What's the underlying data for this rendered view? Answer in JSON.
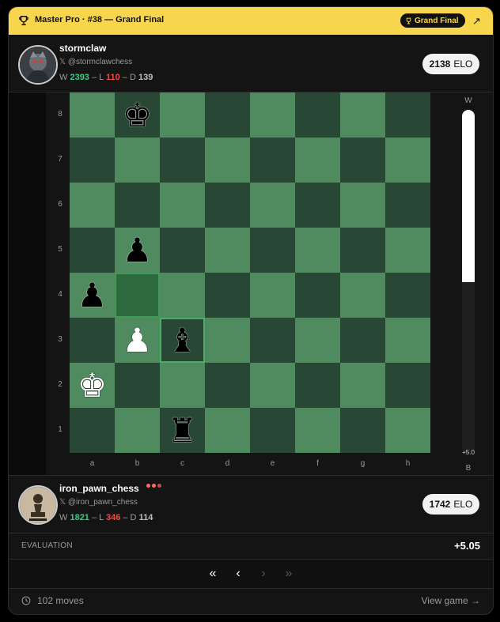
{
  "banner": {
    "title": "Master Pro · #38 — Grand Final",
    "badge_label": "Grand Final",
    "trophy_icon": "trophy-icon",
    "external_icon": "external-link-icon"
  },
  "top_player": {
    "name": "stormclaw",
    "handle": "@stormclawchess",
    "wins_label": "W",
    "wins": "2393",
    "losses_label": "L",
    "losses": "110",
    "draws_label": "D",
    "draws": "139",
    "elo": "2138",
    "elo_label": "ELO"
  },
  "bottom_player": {
    "name": "iron_pawn_chess",
    "handle": "@iron_pawn_chess",
    "wins_label": "W",
    "wins": "1821",
    "losses_label": "L",
    "losses": "346",
    "draws_label": "D",
    "draws": "114",
    "elo": "1742",
    "elo_label": "ELO",
    "status_dot_colors": [
      "#ff6b6b",
      "#ff6b6b",
      "#c94a4a"
    ]
  },
  "board": {
    "ranks": [
      "8",
      "7",
      "6",
      "5",
      "4",
      "3",
      "2",
      "1"
    ],
    "files": [
      "a",
      "b",
      "c",
      "d",
      "e",
      "f",
      "g",
      "h"
    ],
    "pieces": [
      {
        "square": "b8",
        "glyph": "♚",
        "color": "black"
      },
      {
        "square": "b5",
        "glyph": "♟",
        "color": "black"
      },
      {
        "square": "a4",
        "glyph": "♟",
        "color": "black"
      },
      {
        "square": "b3",
        "glyph": "♟",
        "color": "white"
      },
      {
        "square": "c3",
        "glyph": "♝",
        "color": "black"
      },
      {
        "square": "a2",
        "glyph": "♚",
        "color": "white"
      },
      {
        "square": "c1",
        "glyph": "♜",
        "color": "black"
      }
    ],
    "last_move": [
      "b4",
      "c3"
    ],
    "light_color": "#4f8b5e",
    "dark_color": "#284735"
  },
  "eval_bar": {
    "top_label": "W",
    "bottom_label": "B",
    "value_label": "+5.0",
    "white_fraction": 0.5
  },
  "evaluation": {
    "label": "EVALUATION",
    "value": "+5.05"
  },
  "nav": {
    "first": "«",
    "prev": "‹",
    "next": "›",
    "last": "»"
  },
  "footer": {
    "moves": "102 moves",
    "view_game": "View game →",
    "clock_icon": "clock-icon"
  }
}
